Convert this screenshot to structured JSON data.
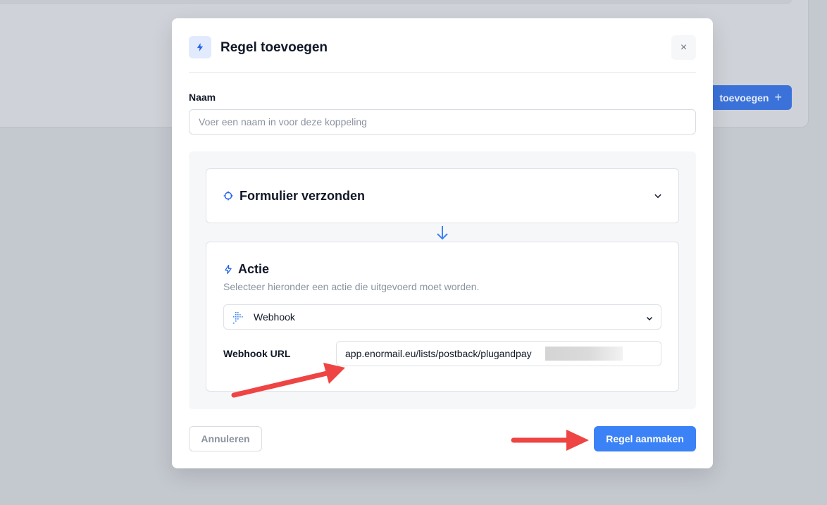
{
  "background": {
    "add_button_label": "toevoegen",
    "add_button_icon": "plus-icon"
  },
  "modal": {
    "title": "Regel toevoegen",
    "header_icon": "bolt-icon",
    "close_icon": "close-icon",
    "close_glyph": "×",
    "name_field": {
      "label": "Naam",
      "value": "",
      "placeholder": "Voer een naam in voor deze koppeling"
    },
    "trigger": {
      "icon": "crosshair-icon",
      "title": "Formulier verzonden",
      "chevron_icon": "chevron-down-icon"
    },
    "flow_arrow_icon": "arrow-down-icon",
    "action": {
      "icon": "bolt-icon",
      "title": "Actie",
      "subtitle": "Selecteer hieronder een actie die uitgevoerd moet worden.",
      "select": {
        "icon": "webhook-icon",
        "value": "Webhook",
        "chevron_icon": "chevron-down-icon"
      },
      "webhook_url": {
        "label": "Webhook URL",
        "value": "app.enormail.eu/lists/postback/plugandpay"
      }
    },
    "footer": {
      "cancel_label": "Annuleren",
      "create_label": "Regel aanmaken"
    }
  },
  "colors": {
    "primary": "#3b82f6",
    "annotation_arrow": "#ef4444",
    "overlay": "#c4c8cf"
  }
}
